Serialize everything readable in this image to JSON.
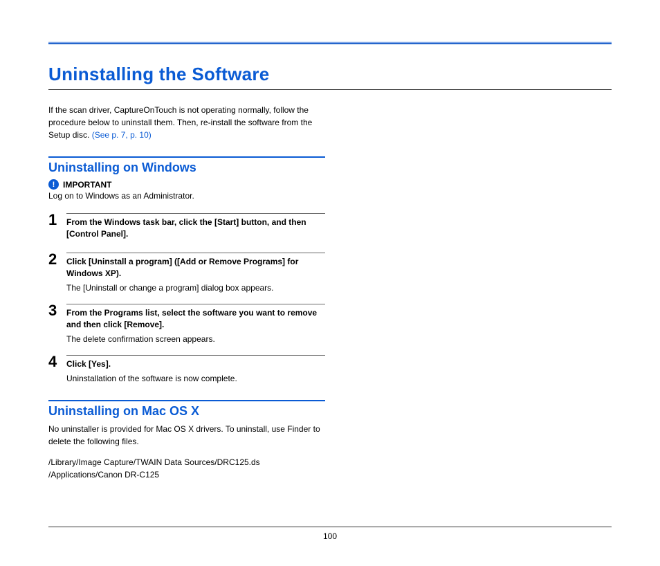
{
  "title": "Uninstalling the Software",
  "intro_text": "If the scan driver, CaptureOnTouch is not operating normally, follow the procedure below to uninstall them. Then, re-install the software from the Setup disc. ",
  "intro_link": "(See p. 7, p. 10)",
  "windows": {
    "heading": "Uninstalling on Windows",
    "important_label": "IMPORTANT",
    "important_text": "Log on to Windows as an Administrator.",
    "steps": [
      {
        "num": "1",
        "title": "From the Windows task bar, click the [Start] button, and then [Control Panel].",
        "desc": ""
      },
      {
        "num": "2",
        "title": "Click [Uninstall a program] ([Add or Remove Programs] for Windows XP).",
        "desc": "The [Uninstall or change a program] dialog box appears."
      },
      {
        "num": "3",
        "title": "From the Programs list, select the software you want to remove and then click [Remove].",
        "desc": "The delete confirmation screen appears."
      },
      {
        "num": "4",
        "title": "Click [Yes].",
        "desc": "Uninstallation of the software is now complete."
      }
    ]
  },
  "mac": {
    "heading": "Uninstalling on Mac OS X",
    "text": "No uninstaller is provided for Mac OS X drivers. To uninstall, use Finder to delete the following files.",
    "paths": [
      "/Library/Image Capture/TWAIN Data Sources/DRC125.ds",
      "/Applications/Canon DR-C125"
    ]
  },
  "page_number": "100"
}
